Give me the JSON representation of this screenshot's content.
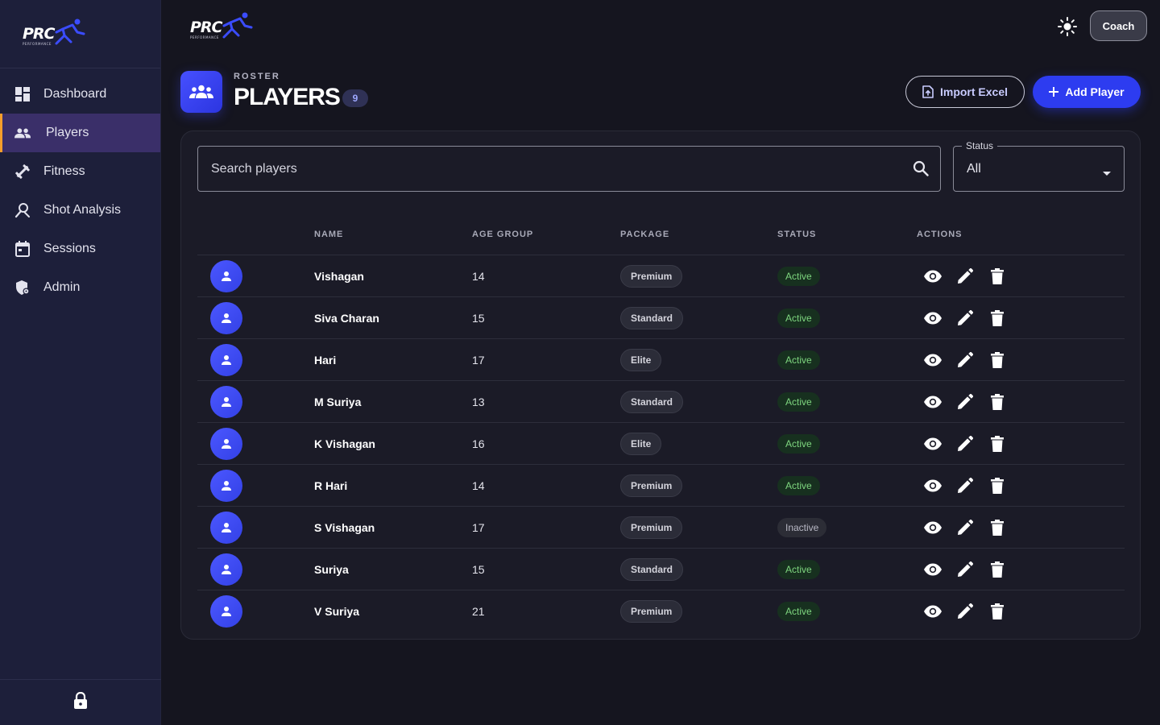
{
  "brand": {
    "logo_text": "PRC",
    "logo_sub": "PERFORMANCE"
  },
  "sidebar": {
    "items": [
      {
        "label": "Dashboard",
        "icon": "dashboard-icon"
      },
      {
        "label": "Players",
        "icon": "people-icon",
        "active": true
      },
      {
        "label": "Fitness",
        "icon": "fitness-icon"
      },
      {
        "label": "Shot Analysis",
        "icon": "shot-analysis-icon"
      },
      {
        "label": "Sessions",
        "icon": "calendar-icon"
      },
      {
        "label": "Admin",
        "icon": "admin-icon"
      }
    ],
    "bottom_icon": "lock-icon"
  },
  "topbar": {
    "theme_icon": "sun-icon",
    "user_label": "Coach"
  },
  "header": {
    "eyebrow": "ROSTER",
    "title": "PLAYERS",
    "count": "9",
    "import_label": "Import Excel",
    "add_label": "Add Player"
  },
  "filters": {
    "search_placeholder": "Search players",
    "status_label": "Status",
    "status_value": "All"
  },
  "table": {
    "columns": [
      "NAME",
      "AGE GROUP",
      "PACKAGE",
      "STATUS",
      "ACTIONS"
    ],
    "rows": [
      {
        "name": "Vishagan",
        "age": "14",
        "package": "Premium",
        "status": "Active"
      },
      {
        "name": "Siva Charan",
        "age": "15",
        "package": "Standard",
        "status": "Active"
      },
      {
        "name": "Hari",
        "age": "17",
        "package": "Elite",
        "status": "Active"
      },
      {
        "name": "M Suriya",
        "age": "13",
        "package": "Standard",
        "status": "Active"
      },
      {
        "name": "K Vishagan",
        "age": "16",
        "package": "Elite",
        "status": "Active"
      },
      {
        "name": "R Hari",
        "age": "14",
        "package": "Premium",
        "status": "Active"
      },
      {
        "name": "S Vishagan",
        "age": "17",
        "package": "Premium",
        "status": "Inactive"
      },
      {
        "name": "Suriya",
        "age": "15",
        "package": "Standard",
        "status": "Active"
      },
      {
        "name": "V Suriya",
        "age": "21",
        "package": "Premium",
        "status": "Active"
      }
    ]
  },
  "colors": {
    "accent": "#2d3cf0",
    "sidebar_bg": "#1d1f3a",
    "active_indicator": "#f59e2b",
    "status_active": "#7ed67f"
  }
}
